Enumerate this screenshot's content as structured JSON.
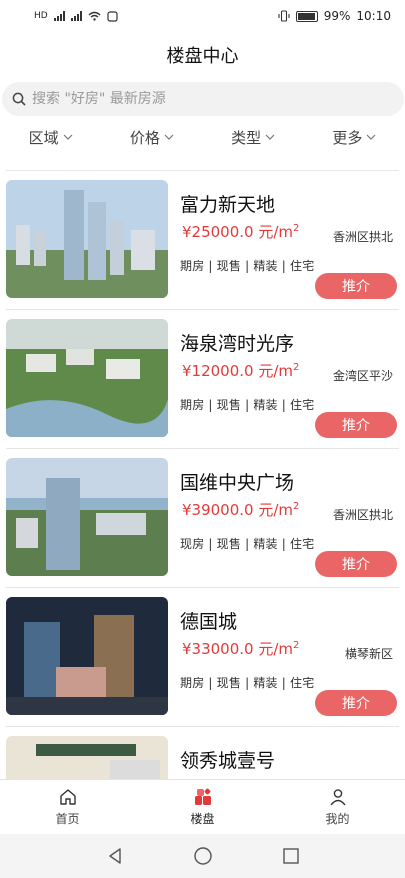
{
  "status_bar": {
    "left_icons": [
      "HD",
      "4G",
      "2G"
    ],
    "battery": "99%",
    "time": "10:10"
  },
  "header": {
    "title": "楼盘中心"
  },
  "search": {
    "placeholder": "搜索 \"好房\" 最新房源"
  },
  "filters": [
    {
      "label": "区域"
    },
    {
      "label": "价格"
    },
    {
      "label": "类型"
    },
    {
      "label": "更多"
    }
  ],
  "listings": [
    {
      "name": "富力新天地",
      "price": "¥25000.0 元/m",
      "unit_sup": "2",
      "district": "香洲区拱北",
      "tags": "期房 | 现售 | 精装 | 住宅",
      "button": "推介"
    },
    {
      "name": "海泉湾时光序",
      "price": "¥12000.0 元/m",
      "unit_sup": "2",
      "district": "金湾区平沙",
      "tags": "期房 | 现售 | 精装 | 住宅",
      "button": "推介"
    },
    {
      "name": "国维中央广场",
      "price": "¥39000.0 元/m",
      "unit_sup": "2",
      "district": "香洲区拱北",
      "tags": "现房 | 现售 | 精装 | 住宅",
      "button": "推介"
    },
    {
      "name": "德国城",
      "price": "¥33000.0 元/m",
      "unit_sup": "2",
      "district": "横琴新区",
      "tags": "期房 | 现售 | 精装 | 住宅",
      "button": "推介"
    },
    {
      "name": "领秀城壹号",
      "price": "",
      "unit_sup": "",
      "district": "",
      "tags": "",
      "button": ""
    }
  ],
  "bottom_nav": [
    {
      "label": "首页",
      "icon": "home-icon"
    },
    {
      "label": "楼盘",
      "icon": "building-icon",
      "active": true
    },
    {
      "label": "我的",
      "icon": "user-icon"
    }
  ],
  "colors": {
    "accent": "#e96566",
    "price": "#e23a3a"
  }
}
